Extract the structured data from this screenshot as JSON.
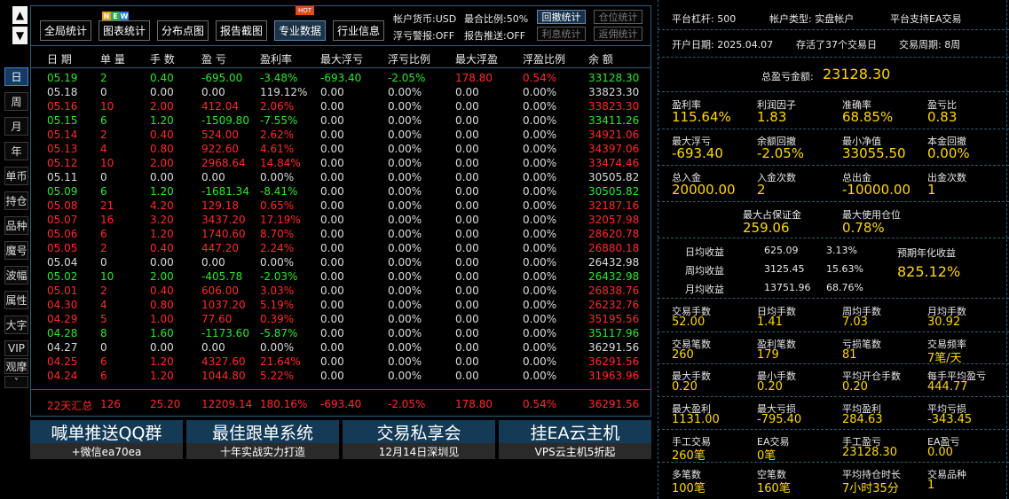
{
  "left_rail": {
    "up": "▲",
    "down": "▼",
    "items": [
      "日",
      "周",
      "月",
      "年",
      "单币",
      "持仓",
      "品种",
      "魔号",
      "波幅",
      "属性",
      "大字",
      "VIP",
      "观摩"
    ],
    "more": "˅"
  },
  "toolbar": {
    "buttons": [
      "全局统计",
      "图表统计",
      "分布点图",
      "报告截图",
      "专业数据",
      "行业信息"
    ],
    "new_badge": [
      "N",
      "E",
      "W"
    ],
    "hot_badge": "HOT",
    "currency": "帐户货币:USD",
    "max_ratio": "最合比例:50%",
    "float_alert": "浮亏警报:OFF",
    "report_push": "报告推送:OFF",
    "btn_withdraw": "回撤统计",
    "btn_position": "仓位统计",
    "btn_interest": "利息统计",
    "btn_rebate": "返佣统计"
  },
  "table": {
    "headers": [
      "日 期",
      "单 量",
      "手 数",
      "盈 亏",
      "盈利率",
      "最大浮亏",
      "浮亏比例",
      "最大浮盈",
      "浮盈比例",
      "余 额"
    ],
    "rows": [
      {
        "c": "g",
        "v": [
          "05.19",
          "2",
          "0.40",
          "-695.00",
          "-3.48%",
          "-693.40",
          "-2.05%",
          "178.80",
          "0.54%",
          "33128.30"
        ]
      },
      {
        "c": "w",
        "v": [
          "05.18",
          "0",
          "0.00",
          "0.00",
          "119.12%",
          "0.00",
          "0.00%",
          "0.00",
          "0.00%",
          "33823.30"
        ]
      },
      {
        "c": "r",
        "v": [
          "05.16",
          "10",
          "2.00",
          "412.04",
          "2.06%",
          "0.00",
          "0.00%",
          "0.00",
          "0.00%",
          "33823.30"
        ]
      },
      {
        "c": "g",
        "v": [
          "05.15",
          "6",
          "1.20",
          "-1509.80",
          "-7.55%",
          "0.00",
          "0.00%",
          "0.00",
          "0.00%",
          "33411.26"
        ]
      },
      {
        "c": "r",
        "v": [
          "05.14",
          "2",
          "0.40",
          "524.00",
          "2.62%",
          "0.00",
          "0.00%",
          "0.00",
          "0.00%",
          "34921.06"
        ]
      },
      {
        "c": "r",
        "v": [
          "05.13",
          "4",
          "0.80",
          "922.60",
          "4.61%",
          "0.00",
          "0.00%",
          "0.00",
          "0.00%",
          "34397.06"
        ]
      },
      {
        "c": "r",
        "v": [
          "05.12",
          "10",
          "2.00",
          "2968.64",
          "14.84%",
          "0.00",
          "0.00%",
          "0.00",
          "0.00%",
          "33474.46"
        ]
      },
      {
        "c": "w",
        "v": [
          "05.11",
          "0",
          "0.00",
          "0.00",
          "0.00%",
          "0.00",
          "0.00%",
          "0.00",
          "0.00%",
          "30505.82"
        ]
      },
      {
        "c": "g",
        "v": [
          "05.09",
          "6",
          "1.20",
          "-1681.34",
          "-8.41%",
          "0.00",
          "0.00%",
          "0.00",
          "0.00%",
          "30505.82"
        ]
      },
      {
        "c": "r",
        "v": [
          "05.08",
          "21",
          "4.20",
          "129.18",
          "0.65%",
          "0.00",
          "0.00%",
          "0.00",
          "0.00%",
          "32187.16"
        ]
      },
      {
        "c": "r",
        "v": [
          "05.07",
          "16",
          "3.20",
          "3437.20",
          "17.19%",
          "0.00",
          "0.00%",
          "0.00",
          "0.00%",
          "32057.98"
        ]
      },
      {
        "c": "r",
        "v": [
          "05.06",
          "6",
          "1.20",
          "1740.60",
          "8.70%",
          "0.00",
          "0.00%",
          "0.00",
          "0.00%",
          "28620.78"
        ]
      },
      {
        "c": "r",
        "v": [
          "05.05",
          "2",
          "0.40",
          "447.20",
          "2.24%",
          "0.00",
          "0.00%",
          "0.00",
          "0.00%",
          "26880.18"
        ]
      },
      {
        "c": "w",
        "v": [
          "05.04",
          "0",
          "0.00",
          "0.00",
          "0.00%",
          "0.00",
          "0.00%",
          "0.00",
          "0.00%",
          "26432.98"
        ]
      },
      {
        "c": "g",
        "v": [
          "05.02",
          "10",
          "2.00",
          "-405.78",
          "-2.03%",
          "0.00",
          "0.00%",
          "0.00",
          "0.00%",
          "26432.98"
        ]
      },
      {
        "c": "r",
        "v": [
          "05.01",
          "2",
          "0.40",
          "606.00",
          "3.03%",
          "0.00",
          "0.00%",
          "0.00",
          "0.00%",
          "26838.76"
        ]
      },
      {
        "c": "r",
        "v": [
          "04.30",
          "4",
          "0.80",
          "1037.20",
          "5.19%",
          "0.00",
          "0.00%",
          "0.00",
          "0.00%",
          "26232.76"
        ]
      },
      {
        "c": "r",
        "v": [
          "04.29",
          "5",
          "1.00",
          "77.60",
          "0.39%",
          "0.00",
          "0.00%",
          "0.00",
          "0.00%",
          "35195.56"
        ]
      },
      {
        "c": "g",
        "v": [
          "04.28",
          "8",
          "1.60",
          "-1173.60",
          "-5.87%",
          "0.00",
          "0.00%",
          "0.00",
          "0.00%",
          "35117.96"
        ]
      },
      {
        "c": "w",
        "v": [
          "04.27",
          "0",
          "0.00",
          "0.00",
          "0.00%",
          "0.00",
          "0.00%",
          "0.00",
          "0.00%",
          "36291.56"
        ]
      },
      {
        "c": "r",
        "v": [
          "04.25",
          "6",
          "1.20",
          "4327.60",
          "21.64%",
          "0.00",
          "0.00%",
          "0.00",
          "0.00%",
          "36291.56"
        ]
      },
      {
        "c": "r",
        "v": [
          "04.24",
          "6",
          "1.20",
          "1044.80",
          "5.22%",
          "0.00",
          "0.00%",
          "0.00",
          "0.00%",
          "31963.96"
        ]
      }
    ],
    "summary": [
      "22天汇总",
      "126",
      "25.20",
      "12209.14",
      "180.16%",
      "-693.40",
      "-2.05%",
      "178.80",
      "0.54%",
      "36291.56"
    ]
  },
  "ads": [
    {
      "title": "喊单推送QQ群",
      "sub": "+微信ea70ea"
    },
    {
      "title": "最佳跟单系统",
      "sub": "十年实战实力打造"
    },
    {
      "title": "交易私享会",
      "sub": "12月14日深圳见"
    },
    {
      "title": "挂EA云主机",
      "sub": "VPS云主机5折起"
    }
  ],
  "right": {
    "leverage": "平台杠杆: 500",
    "account_type": "帐户类型: 实盘帐户",
    "ea_support": "平台支持EA交易",
    "open_date": "开户日期: 2025.04.07",
    "survived": "存活了37个交易日",
    "cycle": "交易周期: 8周",
    "total_label": "总盈亏金额:",
    "total_value": "23128.30",
    "g1": [
      {
        "l": "盈利率",
        "v": "115.64%"
      },
      {
        "l": "利润因子",
        "v": "1.83"
      },
      {
        "l": "准确率",
        "v": "68.85%"
      },
      {
        "l": "盈亏比",
        "v": "0.83"
      },
      {
        "l": "最大浮亏",
        "v": "-693.40"
      },
      {
        "l": "余额回撤",
        "v": "-2.05%"
      },
      {
        "l": "最小净值",
        "v": "33055.50"
      },
      {
        "l": "本金回撤",
        "v": "0.00%"
      },
      {
        "l": "总入金",
        "v": "20000.00"
      },
      {
        "l": "入金次数",
        "v": "2"
      },
      {
        "l": "总出金",
        "v": "-10000.00"
      },
      {
        "l": "出金次数",
        "v": "1"
      }
    ],
    "margin_label": "最大占保证金",
    "margin_value": "259.06",
    "position_label": "最大使用仓位",
    "position_value": "0.78%",
    "daily": [
      {
        "l": "日均收益",
        "a": "625.09",
        "p": "3.13%"
      },
      {
        "l": "周均收益",
        "a": "3125.45",
        "p": "15.63%"
      },
      {
        "l": "月均收益",
        "a": "13751.96",
        "p": "68.76%"
      }
    ],
    "annual_label": "预期年化收益",
    "annual_value": "825.12%",
    "g2": [
      {
        "l": "交易手数",
        "v": "52.00"
      },
      {
        "l": "日均手数",
        "v": "1.41"
      },
      {
        "l": "周均手数",
        "v": "7.03"
      },
      {
        "l": "月均手数",
        "v": "30.92"
      },
      {
        "l": "交易笔数",
        "v": "260"
      },
      {
        "l": "盈利笔数",
        "v": "179"
      },
      {
        "l": "亏损笔数",
        "v": "81"
      },
      {
        "l": "交易频率",
        "v": "7笔/天"
      },
      {
        "l": "最大手数",
        "v": "0.20"
      },
      {
        "l": "最小手数",
        "v": "0.20"
      },
      {
        "l": "平均开仓手数",
        "v": "0.20"
      },
      {
        "l": "每手平均盈亏",
        "v": "444.77"
      },
      {
        "l": "最大盈利",
        "v": "1131.00"
      },
      {
        "l": "最大亏损",
        "v": "-795.40"
      },
      {
        "l": "平均盈利",
        "v": "284.63"
      },
      {
        "l": "平均亏损",
        "v": "-343.45"
      },
      {
        "l": "手工交易",
        "v": "260笔"
      },
      {
        "l": "EA交易",
        "v": "0笔"
      },
      {
        "l": "手工盈亏",
        "v": "23128.30"
      },
      {
        "l": "EA盈亏",
        "v": "0.00"
      },
      {
        "l": "多笔数",
        "v": "100笔"
      },
      {
        "l": "空笔数",
        "v": "160笔"
      },
      {
        "l": "平均持仓时长",
        "v": "7小时35分"
      },
      {
        "l": "交易品种",
        "v": "1"
      }
    ]
  }
}
